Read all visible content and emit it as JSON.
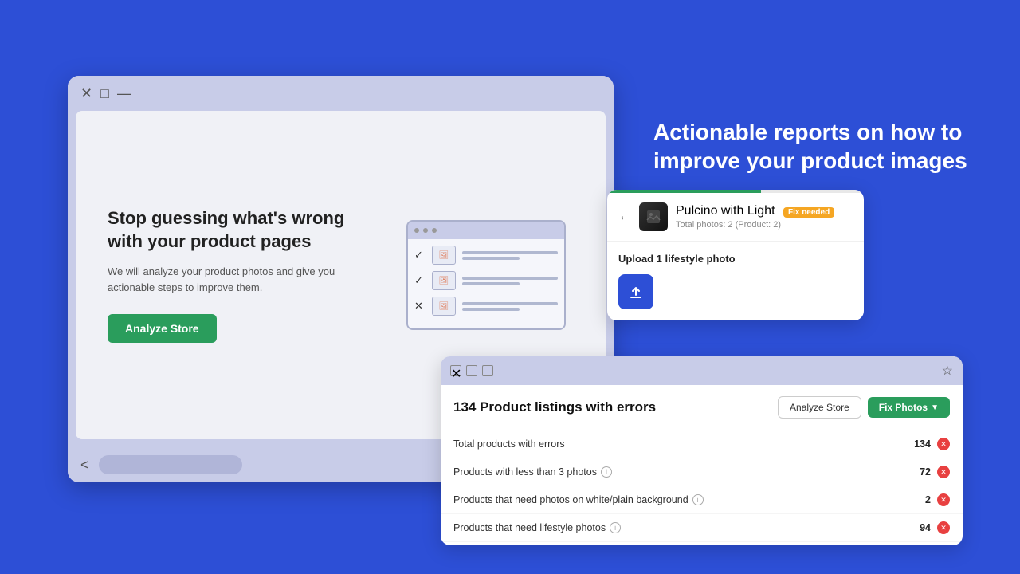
{
  "page": {
    "bg_color": "#2d4fd6"
  },
  "hero": {
    "title": "Actionable reports on how to improve your product images"
  },
  "window_main": {
    "title_bar": {
      "close": "✕",
      "maximize": "□",
      "minimize": "—"
    },
    "content": {
      "heading": "Stop guessing what's wrong with your product pages",
      "description": "We will analyze your product photos and give you actionable steps to improve them.",
      "cta_label": "Analyze Store"
    },
    "illustration": {
      "rows": [
        {
          "check": "✓",
          "icon": "🖼"
        },
        {
          "check": "✓",
          "icon": "🖼"
        },
        {
          "check": "✕",
          "icon": "🖼"
        }
      ]
    },
    "bottom_bar": {
      "back": "<"
    }
  },
  "window_product": {
    "product_name": "Pulcino with Light",
    "fix_badge": "Fix needed",
    "meta": "Total photos: 2 (Product: 2)",
    "upload_label": "Upload 1 lifestyle photo",
    "upload_icon": "⬆"
  },
  "window_errors": {
    "title": "134 Product listings with errors",
    "analyze_label": "Analyze Store",
    "fix_label": "Fix Photos",
    "rows": [
      {
        "label": "Total products with errors",
        "count": "134",
        "has_info": false
      },
      {
        "label": "Products with less than 3 photos",
        "count": "72",
        "has_info": true
      },
      {
        "label": "Products that need photos on white/plain background",
        "count": "2",
        "has_info": true
      },
      {
        "label": "Products that need lifestyle photos",
        "count": "94",
        "has_info": true
      }
    ]
  }
}
